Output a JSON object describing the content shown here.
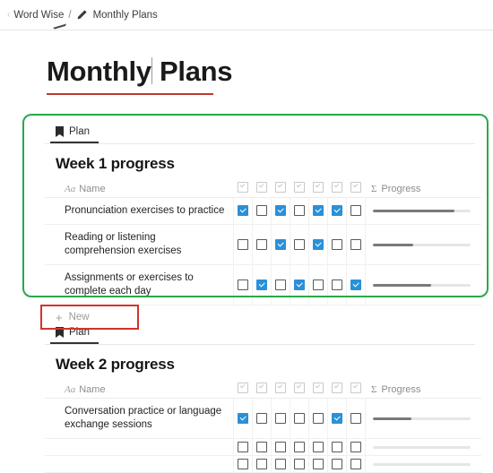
{
  "breadcrumb": {
    "leading_glyph": "‹",
    "root": "Word Wise",
    "separator": "/",
    "edit_icon": "pencil-icon",
    "current": "Monthly Plans"
  },
  "title": {
    "text_before_caret": "Monthly",
    "text_after_caret": " Plans",
    "underline_color": "#c0392b",
    "caret_visible": true
  },
  "colors": {
    "selection_green": "#2aa84a",
    "highlight_red": "#d0342c",
    "checkbox_checked": "#2a90d8",
    "progress_fill": "#7a7a7a",
    "progress_track": "#e6e6e6"
  },
  "cards": [
    {
      "tab_label": "Plan",
      "tab_icon": "bookmark-icon",
      "heading": "Week 1 progress",
      "selected": true,
      "columns": {
        "name_header": "Name",
        "name_type_glyph": "Aa",
        "checkbox_headers": [
          "checkbox-col-1",
          "checkbox-col-2",
          "checkbox-col-3",
          "checkbox-col-4",
          "checkbox-col-5",
          "checkbox-col-6",
          "checkbox-col-7"
        ],
        "progress_header": "Progress",
        "progress_symbol": "Σ"
      },
      "rows": [
        {
          "name": "Pronunciation exercises to practice",
          "checks": [
            true,
            false,
            true,
            false,
            true,
            true,
            false
          ],
          "progress": 84
        },
        {
          "name": "Reading or listening comprehension exercises",
          "checks": [
            false,
            false,
            true,
            false,
            true,
            false,
            false
          ],
          "progress": 42
        },
        {
          "name": "Assignments or exercises to complete each day",
          "checks": [
            false,
            true,
            false,
            true,
            false,
            false,
            true
          ],
          "progress": 60
        }
      ],
      "new_row": {
        "label": "New",
        "plus": "+",
        "highlighted": true
      }
    },
    {
      "tab_label": "Plan",
      "tab_icon": "bookmark-icon",
      "heading": "Week 2 progress",
      "selected": false,
      "columns": {
        "name_header": "Name",
        "name_type_glyph": "Aa",
        "checkbox_headers": [
          "checkbox-col-1",
          "checkbox-col-2",
          "checkbox-col-3",
          "checkbox-col-4",
          "checkbox-col-5",
          "checkbox-col-6",
          "checkbox-col-7"
        ],
        "progress_header": "Progress",
        "progress_symbol": "Σ"
      },
      "rows": [
        {
          "name": "Conversation practice or language exchange sessions",
          "checks": [
            true,
            false,
            false,
            false,
            false,
            true,
            false
          ],
          "progress": 40
        },
        {
          "name": "",
          "checks": [
            false,
            false,
            false,
            false,
            false,
            false,
            false
          ],
          "progress": 0
        },
        {
          "name": "",
          "checks": [
            false,
            false,
            false,
            false,
            false,
            false,
            false
          ],
          "progress": 0
        }
      ],
      "new_row": null
    }
  ]
}
